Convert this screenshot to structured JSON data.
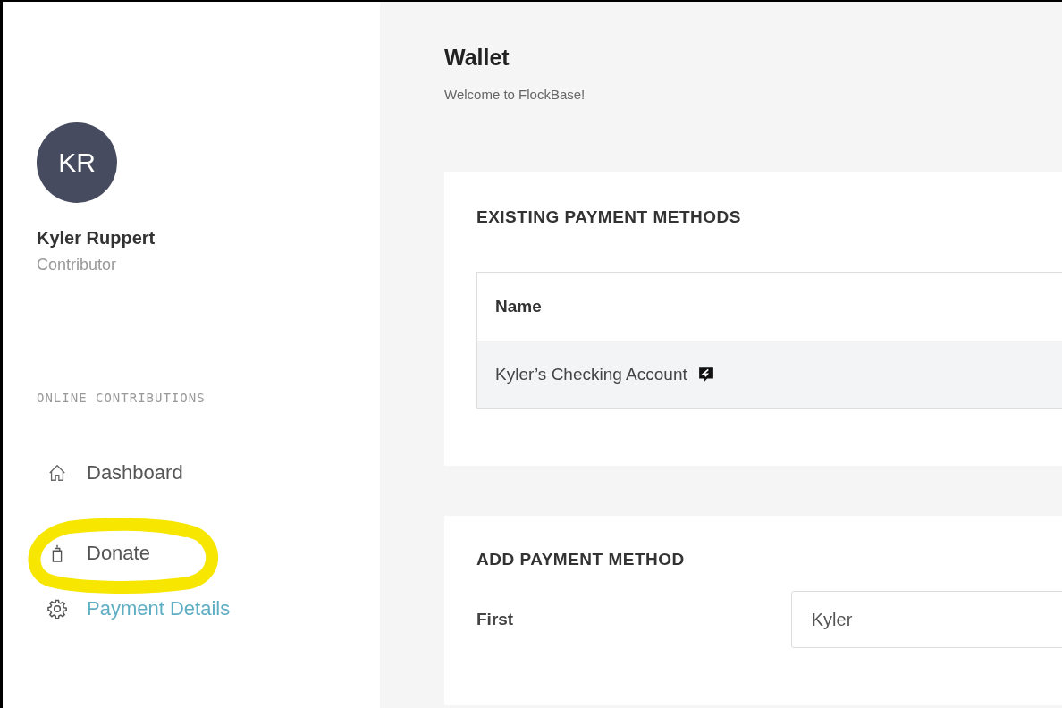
{
  "user": {
    "initials": "KR",
    "name": "Kyler Ruppert",
    "role": "Contributor"
  },
  "sidebar": {
    "section": "ONLINE CONTRIBUTIONS",
    "items": [
      {
        "label": "Dashboard",
        "selected": false
      },
      {
        "label": "Donate",
        "selected": false
      },
      {
        "label": "Payment Details",
        "selected": true
      }
    ]
  },
  "page": {
    "title": "Wallet",
    "subtitle": "Welcome to FlockBase!"
  },
  "existing": {
    "title": "EXISTING PAYMENT METHODS",
    "columns": [
      "Name"
    ],
    "rows": [
      {
        "name": "Kyler’s Checking Account"
      }
    ]
  },
  "add": {
    "title": "ADD PAYMENT METHOD",
    "fields": [
      {
        "label": "First",
        "value": "Kyler"
      }
    ]
  }
}
